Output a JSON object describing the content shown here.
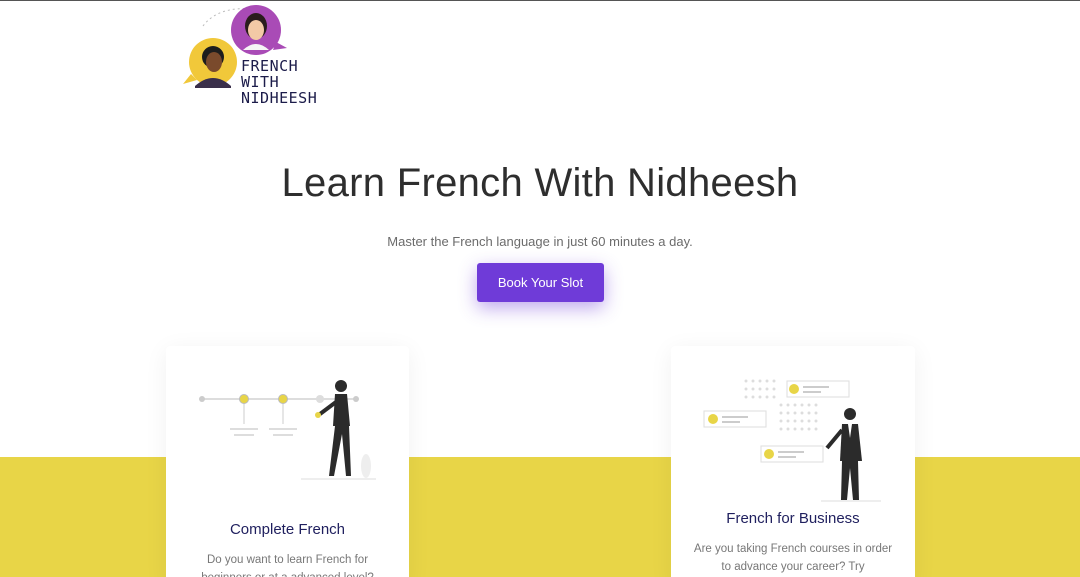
{
  "brand": {
    "logo_lines": [
      "FRENCH",
      "WITH",
      "NIDHEESH"
    ],
    "colors": {
      "bubble_purple": "#a94bb6",
      "bubble_yellow": "#f1c83a",
      "text_navy": "#1c1c4a"
    }
  },
  "hero": {
    "title": "Learn French With Nidheesh",
    "subtitle": "Master the French language in just 60 minutes a day.",
    "cta_label": "Book Your Slot",
    "cta_color": "#6f3bd8"
  },
  "accent": {
    "band_color": "#e8d547"
  },
  "cards": [
    {
      "title": "Complete French",
      "description": "Do you want to learn French for beginners or at a advanced level?",
      "illustration": "person-timeline-illustration"
    },
    {
      "title": "French for Business",
      "description": "Are you taking French courses in order to advance your career? Try",
      "illustration": "businessman-chat-illustration"
    }
  ]
}
